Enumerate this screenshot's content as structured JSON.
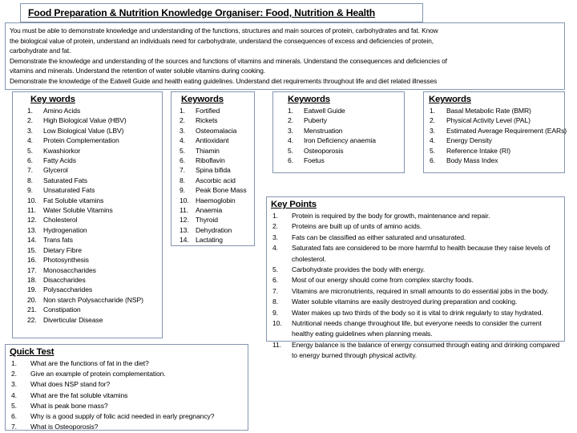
{
  "title": {
    "text": "Food Preparation & Nutrition Knowledge Organiser: Food, Nutrition & Health"
  },
  "intro": {
    "lines": [
      "You must be able to demonstrate knowledge and understanding of the functions, structures and main sources of protein, carbohydrates and fat.  Know",
      "the biological value of protein, understand an individuals need for carbohydrate, understand the consequences of excess and deficiencies of protein,",
      "carbohydrate and fat.",
      "Demonstrate the knowledge and understanding of the sources and functions of vitamins and minerals.  Understand the consequences and deficiencies of",
      "vitamins and minerals.  Understand the retention of water soluble vitamins during cooking.",
      "Demonstrate the knowledge of the Eatwell Guide and health eating guidelines.  Understand diet requirements throughout life and diet related illnesses"
    ]
  },
  "keywords1": {
    "heading": "Key words",
    "items": [
      "Amino Acids",
      "High Biological Value (HBV)",
      "Low Biological Value (LBV)",
      "Protein Complementation",
      "Kwashiorkor",
      "Fatty Acids",
      "Glycerol",
      "Saturated Fats",
      "Unsaturated Fats",
      "Fat Soluble vitamins",
      "Water Soluble Vitamins",
      "Cholesterol",
      "Hydrogenation",
      "Trans fats",
      "Dietary Fibre",
      "Photosynthesis",
      "Monosaccharides",
      "Disaccharides",
      "Polysaccharides",
      "Non starch Polysaccharide (NSP)",
      "Constipation",
      "Diverticular Disease"
    ]
  },
  "keywords2": {
    "heading": "Keywords",
    "items": [
      "Fortified",
      "Rickets",
      "Osteomalacia",
      "Antioxidant",
      "Thiamin",
      "Riboflavin",
      "Spina bifida",
      "Ascorbic acid",
      "Peak Bone Mass",
      "Haemoglobin",
      "Anaemia",
      "Thyroid",
      "Dehydration",
      "Lactating"
    ]
  },
  "keywords3": {
    "heading": "Keywords",
    "items": [
      "Eatwell Guide",
      "Puberty",
      "Menstruation",
      "Iron Deficiency anaemia",
      "Osteoporosis",
      "Foetus"
    ]
  },
  "keywords4": {
    "heading": "Keywords",
    "items": [
      "Basal Metabolic Rate (BMR)",
      "Physical Activity Level (PAL)",
      "Estimated Average Requirement (EARs)",
      "Energy Density",
      "Reference Intake (RI)",
      "Body Mass Index"
    ]
  },
  "key_points": {
    "heading": "Key Points",
    "items": [
      "Protein is required by the body for growth, maintenance and repair.",
      "Proteins are built up of units of amino acids.",
      "Fats can be classified as either saturated and unsaturated.",
      "Saturated fats are considered to be more harmful to health because they raise levels of cholesterol.",
      "Carbohydrate provides the body with energy.",
      "Most of our energy should come from complex starchy foods.",
      "Vitamins are micronutrients, required in small amounts to do essential jobs in the body.",
      "Water soluble vitamins are easily destroyed during preparation and cooking.",
      "Water makes up two thirds of the body so it is vital to drink regularly to stay hydrated.",
      "Nutritional needs change throughout life, but everyone needs to consider the current healthy eating guidelines when planning meals.",
      "Energy balance is the balance of energy consumed through eating and drinking compared to energy burned through physical activity."
    ]
  },
  "quick_test": {
    "heading": "Quick Test",
    "items": [
      "What are the functions of fat in the diet?",
      "Give an example of protein complementation.",
      "What does NSP stand for?",
      "What are the fat soluble vitamins",
      "What is peak bone mass?",
      "Why is a good supply of folic acid needed in early pregnancy?",
      "What is Osteoporosis?"
    ]
  },
  "colors": {
    "border": "#8496b0",
    "text": "#000000",
    "background": "#ffffff"
  }
}
